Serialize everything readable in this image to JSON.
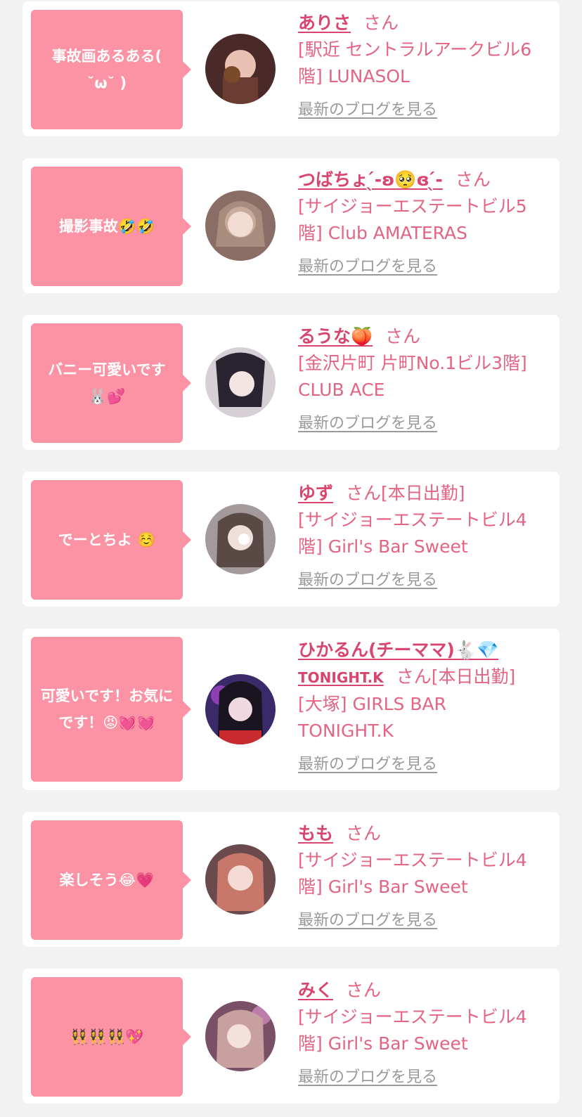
{
  "items": [
    {
      "comment": "事故画あるある(\n˘ω˘ )",
      "name": "ありさ",
      "suffix": "さん",
      "shop": "[駅近 セントラルアークビル6階] LUNASOL",
      "blog_link": "最新のブログを見る",
      "avatar_color": "#4a2a28"
    },
    {
      "comment": "撮影事故🤣🤣",
      "name": "つばちょ‪‪ ̖́-‬ʚ🥺ɞ ̖́-‬",
      "suffix": "さん",
      "shop": "[サイジョーエステートビル5階] Club AMATERAS",
      "blog_link": "最新のブログを見る",
      "avatar_color": "#8a6e66"
    },
    {
      "comment": "バニー可愛いです\n🐰💕",
      "name": "るうな🍑",
      "suffix": "さん",
      "shop": "[金沢片町 片町No.1ビル3階] CLUB ACE",
      "blog_link": "最新のブログを見る",
      "avatar_color": "#d6cfd6"
    },
    {
      "comment": "でーとちよ ☺️",
      "name": "ゆず",
      "suffix": "さん[本日出勤]",
      "shop": "[サイジョーエステートビル4階] Girl's Bar Sweet",
      "blog_link": "最新のブログを見る",
      "avatar_color": "#a49a9c"
    },
    {
      "comment": "可愛いです！お気にです！😡💓💓",
      "name": "ひかるん(チーママ)🐇💎",
      "subname": "TONIGHT.K",
      "suffix": "さん[本日出勤]",
      "shop": "[大塚] GIRLS BAR TONIGHT.K",
      "blog_link": "最新のブログを見る",
      "avatar_color": "#3a2a6a"
    },
    {
      "comment": "楽しそう😂💗",
      "name": "もも",
      "suffix": "さん",
      "shop": "[サイジョーエステートビル4階] Girl's Bar Sweet",
      "blog_link": "最新のブログを見る",
      "avatar_color": "#6a4a4c"
    },
    {
      "comment": "👯‍♀️👯‍♀️👯‍♀️💖",
      "name": "みく",
      "suffix": "さん",
      "shop": "[サイジョーエステートビル4階] Girl's Bar Sweet",
      "blog_link": "最新のブログを見る",
      "avatar_color": "#7a5066"
    }
  ]
}
